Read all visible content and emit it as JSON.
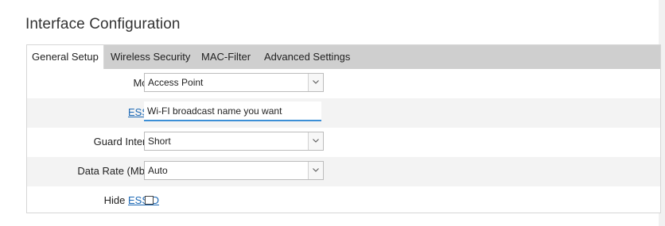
{
  "page": {
    "title": "Interface Configuration"
  },
  "tabs": [
    {
      "label": "General Setup",
      "active": true
    },
    {
      "label": "Wireless Security",
      "active": false
    },
    {
      "label": "MAC-Filter",
      "active": false
    },
    {
      "label": "Advanced Settings",
      "active": false
    }
  ],
  "form": {
    "mode": {
      "label": "Mode",
      "value": "Access Point"
    },
    "essid": {
      "label": "ESSID",
      "value": "Wi-FI broadcast name you want"
    },
    "guard_interval": {
      "label": "Guard Interval",
      "value": "Short"
    },
    "data_rate": {
      "label": "Data Rate (Mbps)",
      "value": "Auto"
    },
    "hide_essid": {
      "label_prefix": "Hide",
      "label_link": "ESSID",
      "checked": false
    }
  },
  "colors": {
    "tab_bar": "#cfcfcf",
    "link": "#1a67b4",
    "input_focus": "#3c8fd6"
  }
}
